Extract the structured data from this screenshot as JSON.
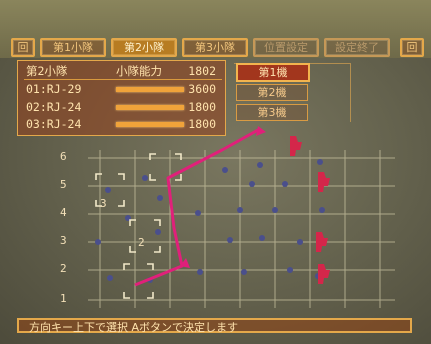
{
  "tabs": [
    {
      "label": "回",
      "active": false
    },
    {
      "label": "第1小隊",
      "active": false
    },
    {
      "label": "第2小隊",
      "active": true
    },
    {
      "label": "第3小隊",
      "active": false
    },
    {
      "label": "位置設定",
      "active": false
    },
    {
      "label": "設定終了",
      "active": false
    },
    {
      "label": "回",
      "active": false
    }
  ],
  "squad_panel": {
    "header": {
      "name": "第2小隊",
      "capacity_label": "小隊能力",
      "total": "1802"
    },
    "units": [
      {
        "name": "01:RJ-29",
        "value": "3600"
      },
      {
        "name": "02:RJ-24",
        "value": "1800"
      },
      {
        "name": "03:RJ-24",
        "value": "1800"
      }
    ]
  },
  "machine_menu": {
    "items": [
      {
        "label": "第1機",
        "selected": true
      },
      {
        "label": "第2機",
        "selected": false
      },
      {
        "label": "第3機",
        "selected": false
      }
    ]
  },
  "grid": {
    "row_labels": [
      "6",
      "5",
      "4",
      "3",
      "2",
      "1"
    ],
    "slot_labels": [
      "3",
      "2"
    ]
  },
  "status": {
    "text": "方向キー上下で選択 Aボタンで決定します"
  },
  "colors": {
    "accent": "#e4a84a",
    "enemy": "#d4264a",
    "path": "#e0207a",
    "dot": "#4a4f8c"
  }
}
